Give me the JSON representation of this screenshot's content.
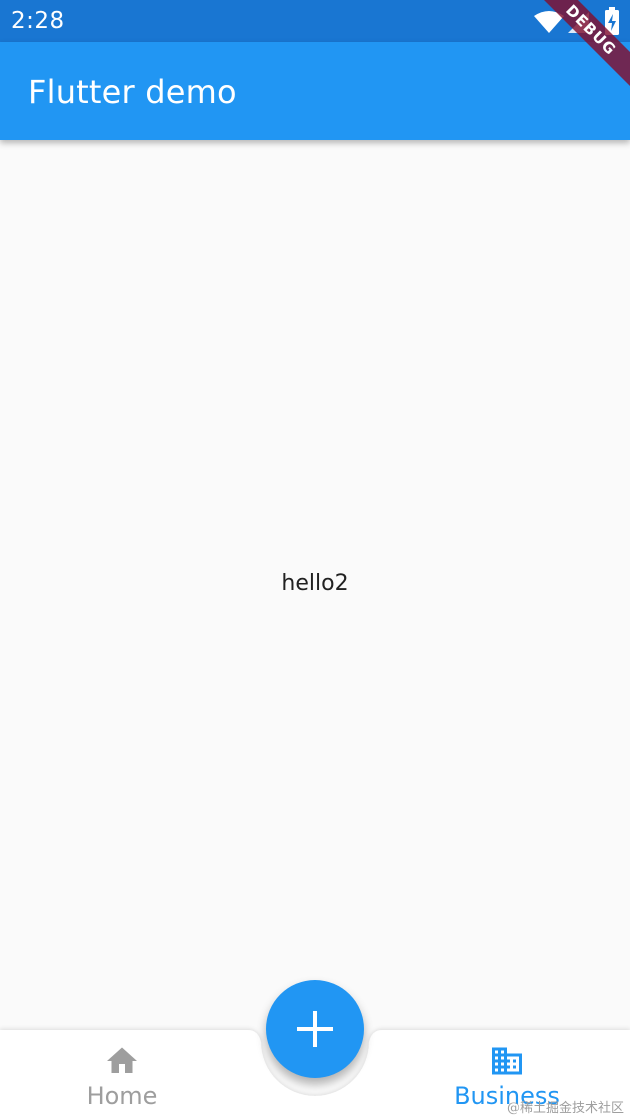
{
  "status_bar": {
    "time": "2:28",
    "icons": [
      "wifi-icon",
      "signal-icon",
      "battery-charging-icon"
    ],
    "background": "#1976d2"
  },
  "debug_banner": {
    "label": "DEBUG"
  },
  "app_bar": {
    "title": "Flutter demo",
    "background": "#2196f3"
  },
  "body": {
    "text": "hello2"
  },
  "fab": {
    "icon": "add-icon",
    "color": "#2196f3"
  },
  "bottom_nav": {
    "items": [
      {
        "label": "Home",
        "icon": "home-icon",
        "selected": false,
        "color": "#9e9e9e"
      },
      {
        "label": "Business",
        "icon": "business-icon",
        "selected": true,
        "color": "#2196f3"
      }
    ]
  },
  "watermark": "@稀土掘金技术社区"
}
